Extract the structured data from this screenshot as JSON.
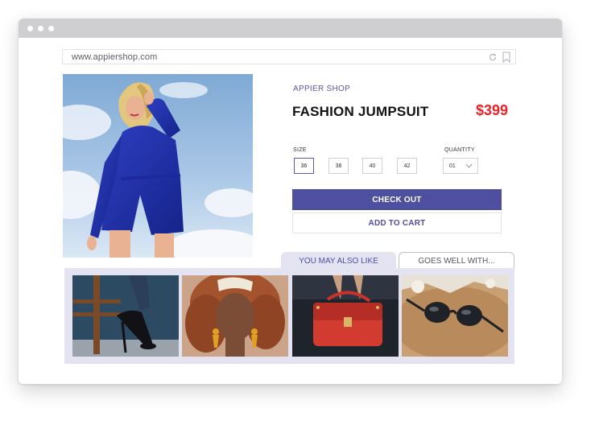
{
  "browser": {
    "url": "www.appiershop.com"
  },
  "product": {
    "shop_label": "APPIER SHOP",
    "title": "FASHION JUMPSUIT",
    "price": "$399",
    "size_label": "SIZE",
    "sizes": [
      "36",
      "38",
      "40",
      "42"
    ],
    "selected_size": "36",
    "quantity_label": "QUANTITY",
    "quantity_value": "01"
  },
  "actions": {
    "checkout_label": "CHECK OUT",
    "add_to_cart_label": "ADD TO CART"
  },
  "recommendations": {
    "tabs": [
      {
        "label": "YOU MAY ALSO LIKE",
        "active": true
      },
      {
        "label": "GOES WELL WITH...",
        "active": false
      }
    ],
    "items": [
      {
        "name": "heels-image"
      },
      {
        "name": "earrings-model-image"
      },
      {
        "name": "red-handbag-image"
      },
      {
        "name": "sunglasses-image"
      }
    ]
  },
  "colors": {
    "accent": "#4f4f9f",
    "price": "#e8232a",
    "panel": "#e4e3f1"
  }
}
